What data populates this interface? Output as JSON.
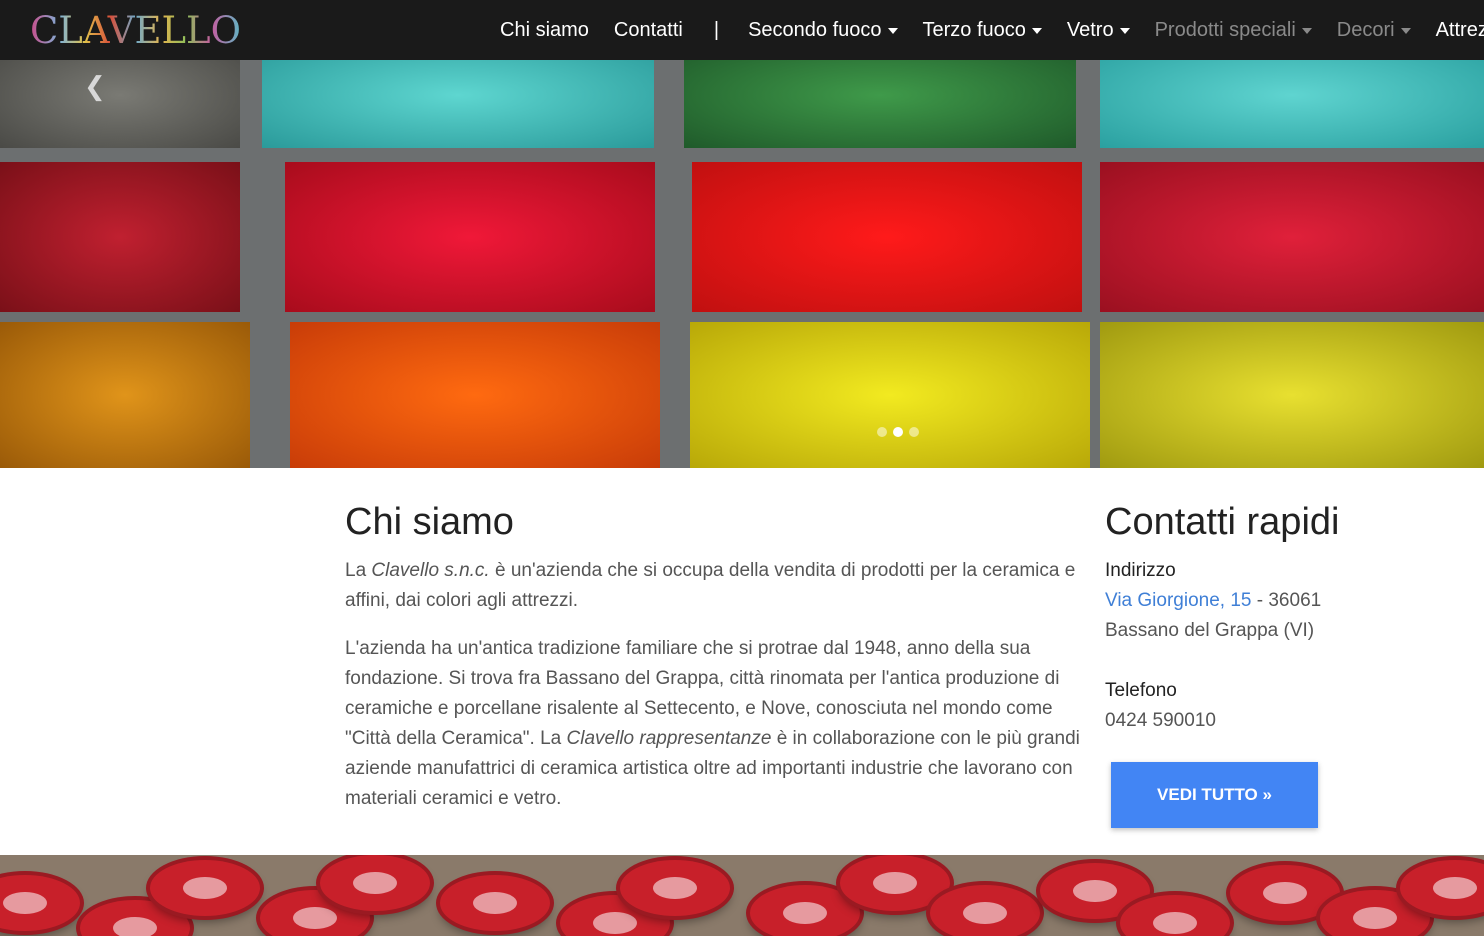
{
  "navbar": {
    "brand": "CLAVELLO",
    "items": [
      {
        "label": "Chi siamo",
        "dropdown": false,
        "muted": false
      },
      {
        "label": "Contatti",
        "dropdown": false,
        "muted": false
      },
      {
        "label": "Secondo fuoco",
        "dropdown": true,
        "muted": false
      },
      {
        "label": "Terzo fuoco",
        "dropdown": true,
        "muted": false
      },
      {
        "label": "Vetro",
        "dropdown": true,
        "muted": false
      },
      {
        "label": "Prodotti speciali",
        "dropdown": true,
        "muted": true
      },
      {
        "label": "Decori",
        "dropdown": true,
        "muted": true
      },
      {
        "label": "Attrez",
        "dropdown": false,
        "muted": false
      }
    ],
    "separator": "|"
  },
  "carousel": {
    "prev_icon": "chevron-left-icon",
    "slide_count": 3,
    "active_slide": 2
  },
  "about": {
    "title": "Chi siamo",
    "p1_a": "La ",
    "p1_em": "Clavello s.n.c.",
    "p1_b": " è un'azienda che si occupa della vendita di prodotti per la ceramica e affini, dai colori agli attrezzi.",
    "p2_a": "L'azienda ha un'antica tradizione familiare che si protrae dal 1948, anno della sua fondazione. Si trova fra Bassano del Grappa, città rinomata per l'antica produzione di ceramiche e porcellane risalente al Settecento, e Nove, conosciuta nel mondo come \"Città della Ceramica\". La ",
    "p2_em": "Clavello rappresentanze",
    "p2_b": " è in collaborazione con le più grandi aziende manufattrici di ceramica artistica oltre ad importanti industrie che lavorano con materiali ceramici e vetro."
  },
  "contacts": {
    "title": "Contatti rapidi",
    "address_label": "Indirizzo",
    "address_link": "Via Giorgione, 15",
    "address_rest": " - 36061",
    "address_city": "Bassano del Grappa (VI)",
    "phone_label": "Telefono",
    "phone": "0424 590010",
    "button": "VEDI TUTTO »"
  },
  "colors": {
    "navbar_bg": "#1a1a1a",
    "link": "#3f7fd6",
    "button": "#4285f4"
  }
}
